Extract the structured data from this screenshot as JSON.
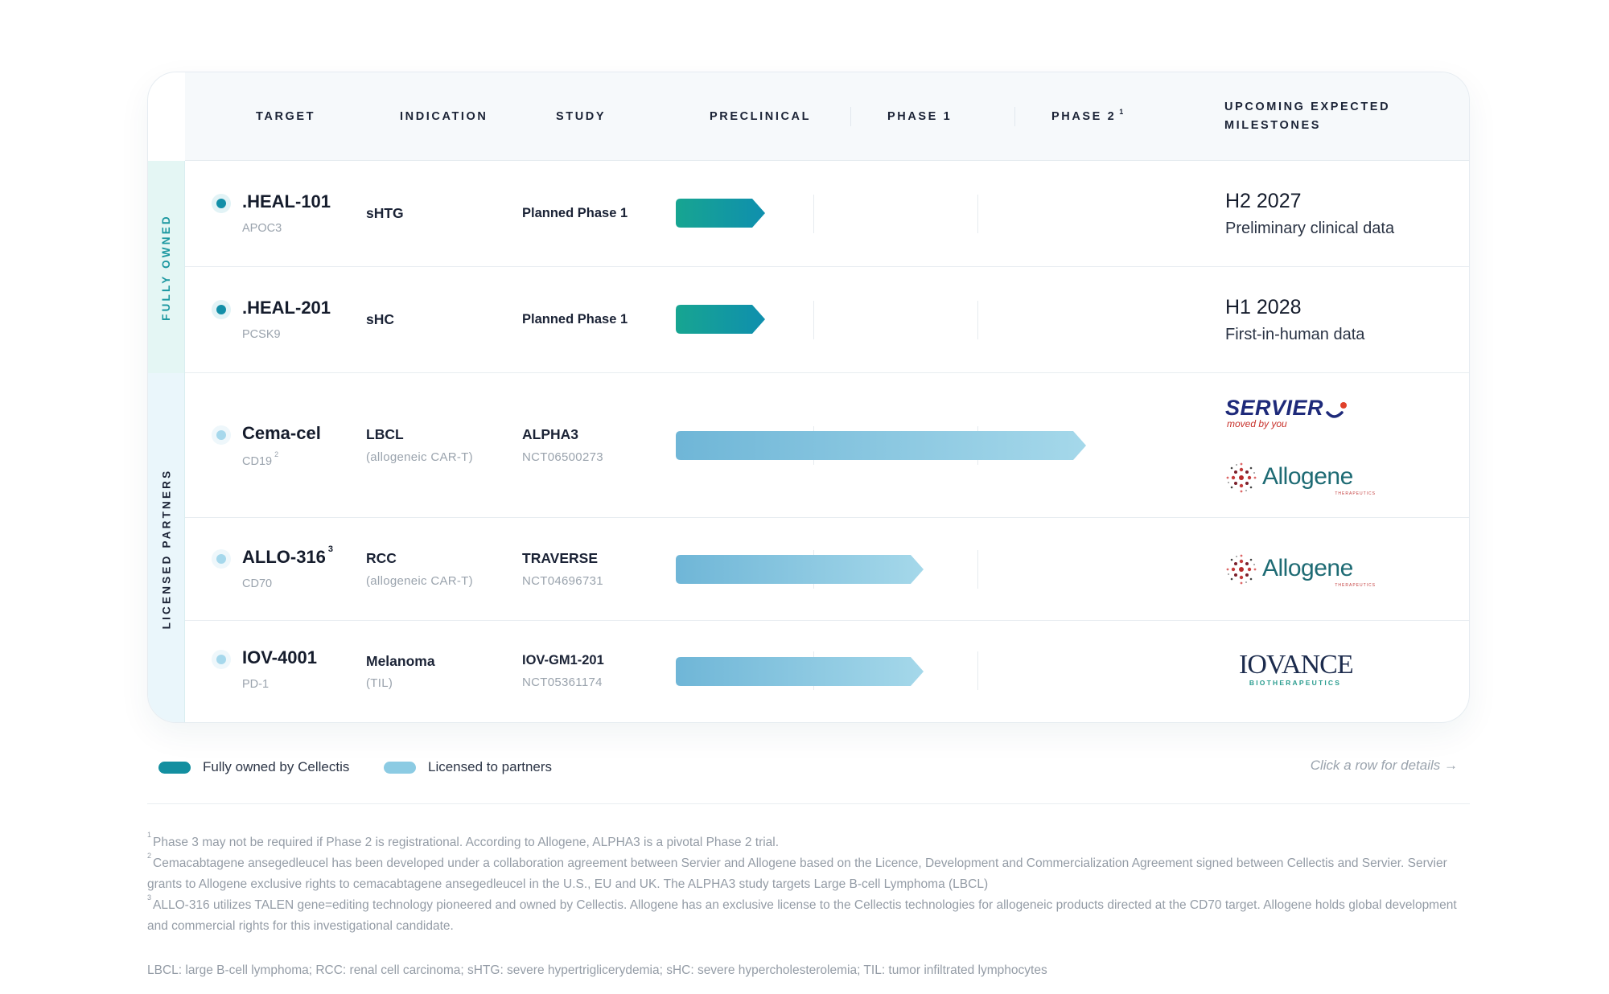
{
  "headers": {
    "target": "TARGET",
    "indication": "INDICATION",
    "study": "STUDY",
    "preclinical": "PRECLINICAL",
    "phase1": "PHASE 1",
    "phase2": "PHASE 2",
    "phase2_sup": "1",
    "milestones_line1": "UPCOMING EXPECTED",
    "milestones_line2": "MILESTONES"
  },
  "groups": {
    "owned": "FULLY OWNED",
    "licensed": "LICENSED PARTNERS"
  },
  "rows": [
    {
      "target": ".HEAL-101",
      "target_sup": "",
      "gene": "APOC3",
      "gene_sup": "",
      "indication": "sHTG",
      "indication_sub": "",
      "study": "Planned Phase 1",
      "study_sub": "",
      "ownership": "owned",
      "progress_phase": 0.5,
      "milestone_date": "H2 2027",
      "milestone_text": "Preliminary clinical data",
      "partners": []
    },
    {
      "target": ".HEAL-201",
      "target_sup": "",
      "gene": "PCSK9",
      "gene_sup": "",
      "indication": "sHC",
      "indication_sub": "",
      "study": "Planned Phase 1",
      "study_sub": "",
      "ownership": "owned",
      "progress_phase": 0.5,
      "milestone_date": "H1 2028",
      "milestone_text": "First-in-human data",
      "partners": []
    },
    {
      "target": "Cema-cel",
      "target_sup": "",
      "gene": "CD19",
      "gene_sup": "2",
      "indication": "LBCL",
      "indication_sub": "(allogeneic CAR-T)",
      "study": "ALPHA3",
      "study_sub": "NCT06500273",
      "ownership": "licensed",
      "progress_phase": 2.5,
      "milestone_date": "",
      "milestone_text": "",
      "partners": [
        "servier-logo",
        "allogene-logo"
      ]
    },
    {
      "target": "ALLO-316",
      "target_sup": "3",
      "gene": "CD70",
      "gene_sup": "",
      "indication": "RCC",
      "indication_sub": "(allogeneic CAR-T)",
      "study": "TRAVERSE",
      "study_sub": "NCT04696731",
      "ownership": "licensed",
      "progress_phase": 1.5,
      "milestone_date": "",
      "milestone_text": "",
      "partners": [
        "allogene-logo"
      ]
    },
    {
      "target": "IOV-4001",
      "target_sup": "",
      "gene": "PD-1",
      "gene_sup": "",
      "indication": "Melanoma",
      "indication_sub": "(TIL)",
      "study": "IOV-GM1-201",
      "study_sub": "NCT05361174",
      "ownership": "licensed",
      "progress_phase": 1.5,
      "milestone_date": "",
      "milestone_text": "",
      "partners": [
        "iovance-logo"
      ]
    }
  ],
  "logos": {
    "servier_word": "SERVIER",
    "servier_tagline": "moved by you",
    "allogene_word": "Allogene",
    "allogene_tagline": "THERAPEUTICS",
    "iovance_word": "IOVANCE",
    "iovance_tagline": "BIOTHERAPEUTICS"
  },
  "legend": {
    "owned": "Fully owned by Cellectis",
    "licensed": "Licensed to partners",
    "cta": "Click a row for details →"
  },
  "colors": {
    "owned_bar_start": "#17a591",
    "owned_bar_end": "#0f8fae",
    "licensed_bar_start": "#6fb6d7",
    "licensed_bar_end": "#a5d8ea",
    "owned_dot": "#138fa8",
    "licensed_dot": "#a6d8ec"
  },
  "footnotes": {
    "fn1_mark": "1",
    "fn1": "Phase 3 may not be required if Phase 2 is registrational. According to Allogene, ALPHA3 is a pivotal Phase 2 trial.",
    "fn2_mark": "2",
    "fn2": "Cemacabtagene ansegedleucel has been developed under a collaboration agreement between Servier and Allogene based on the Licence, Development and Commercialization Agreement signed between Cellectis and Servier. Servier grants to Allogene exclusive rights to cemacabtagene ansegedleucel in the U.S., EU and UK. The ALPHA3 study targets Large B-cell Lymphoma (LBCL)",
    "fn3_mark": "3",
    "fn3": "ALLO-316 utilizes TALEN gene=editing technology pioneered and owned by Cellectis. Allogene has an exclusive license to the Cellectis technologies for allogeneic products directed at the CD70 target. Allogene holds global development and commercial rights for this investigational candidate.",
    "abbrev": "LBCL: large B-cell lymphoma; RCC: renal cell carcinoma; sHTG: severe hypertriglicerydemia; sHC: severe hypercholesterolemia; TIL: tumor infiltrated lymphocytes"
  }
}
